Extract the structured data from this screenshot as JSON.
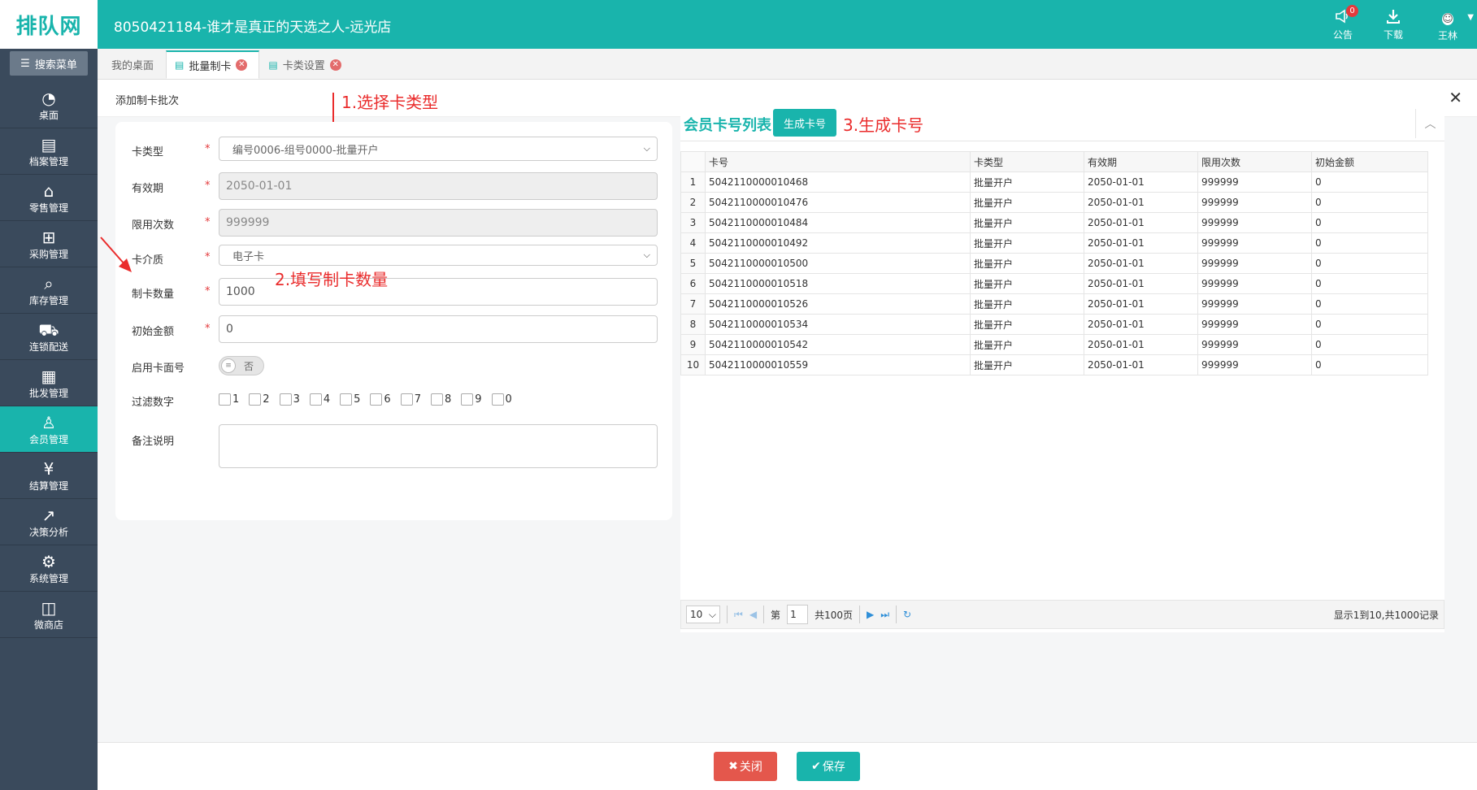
{
  "header": {
    "logo_text": "排队网",
    "title": "8050421184-谁才是真正的天选之人-远光店",
    "actions": [
      {
        "label": "公告",
        "icon": "speaker-icon",
        "badge": "0"
      },
      {
        "label": "下载",
        "icon": "download-icon"
      },
      {
        "label": "王林",
        "icon": "user-avatar-icon"
      }
    ]
  },
  "sidebar": {
    "search_label": "搜索菜单",
    "items": [
      {
        "label": "桌面",
        "icon": "dashboard-icon"
      },
      {
        "label": "档案管理",
        "icon": "archive-icon"
      },
      {
        "label": "零售管理",
        "icon": "store-icon"
      },
      {
        "label": "采购管理",
        "icon": "cart-icon"
      },
      {
        "label": "库存管理",
        "icon": "inventory-search-icon"
      },
      {
        "label": "连锁配送",
        "icon": "truck-icon"
      },
      {
        "label": "批发管理",
        "icon": "wholesale-icon"
      },
      {
        "label": "会员管理",
        "icon": "member-icon",
        "active": true
      },
      {
        "label": "结算管理",
        "icon": "settlement-icon"
      },
      {
        "label": "决策分析",
        "icon": "chart-icon"
      },
      {
        "label": "系统管理",
        "icon": "gear-icon"
      },
      {
        "label": "微商店",
        "icon": "shop-bag-icon"
      }
    ]
  },
  "tabs": [
    {
      "label": "我的桌面"
    },
    {
      "label": "批量制卡",
      "active": true
    },
    {
      "label": "卡类设置"
    }
  ],
  "panel": {
    "title": "添加制卡批次",
    "close_glyph": "✕"
  },
  "annotations": {
    "step1": "1.选择卡类型",
    "step2": "2.填写制卡数量",
    "step3": "3.生成卡号"
  },
  "form": {
    "card_type": {
      "label": "卡类型",
      "value": "编号0006-组号0000-批量开户"
    },
    "valid_until": {
      "label": "有效期",
      "value": "2050-01-01"
    },
    "limit_times": {
      "label": "限用次数",
      "value": "999999"
    },
    "medium": {
      "label": "卡介质",
      "value": "电子卡"
    },
    "count": {
      "label": "制卡数量",
      "value": "1000"
    },
    "initial_amount": {
      "label": "初始金额",
      "value": "0"
    },
    "enable_face_no": {
      "label": "启用卡面号",
      "toggle_text": "否",
      "knob_glyph": "≡"
    },
    "filter_digits": {
      "label": "过滤数字",
      "digits": [
        "1",
        "2",
        "3",
        "4",
        "5",
        "6",
        "7",
        "8",
        "9",
        "0"
      ]
    },
    "remark": {
      "label": "备注说明",
      "value": ""
    },
    "required_mark": "*"
  },
  "card_list": {
    "title": "会员卡号列表",
    "generate_button": "生成卡号",
    "columns": [
      "卡号",
      "卡类型",
      "有效期",
      "限用次数",
      "初始金额"
    ],
    "rows": [
      [
        "5042110000010468",
        "批量开户",
        "2050-01-01",
        "999999",
        "0"
      ],
      [
        "5042110000010476",
        "批量开户",
        "2050-01-01",
        "999999",
        "0"
      ],
      [
        "5042110000010484",
        "批量开户",
        "2050-01-01",
        "999999",
        "0"
      ],
      [
        "5042110000010492",
        "批量开户",
        "2050-01-01",
        "999999",
        "0"
      ],
      [
        "5042110000010500",
        "批量开户",
        "2050-01-01",
        "999999",
        "0"
      ],
      [
        "5042110000010518",
        "批量开户",
        "2050-01-01",
        "999999",
        "0"
      ],
      [
        "5042110000010526",
        "批量开户",
        "2050-01-01",
        "999999",
        "0"
      ],
      [
        "5042110000010534",
        "批量开户",
        "2050-01-01",
        "999999",
        "0"
      ],
      [
        "5042110000010542",
        "批量开户",
        "2050-01-01",
        "999999",
        "0"
      ],
      [
        "5042110000010559",
        "批量开户",
        "2050-01-01",
        "999999",
        "0"
      ]
    ],
    "pager": {
      "page_size": "10",
      "page_prefix": "第",
      "page": "1",
      "total_pages": "共100页",
      "info": "显示1到10,共1000记录"
    }
  },
  "footer": {
    "close_label": "关闭",
    "save_label": "保存"
  },
  "colors": {
    "brand": "#19b4ac",
    "sidebar": "#3a4a5c",
    "danger": "#e4574c",
    "annotation": "#ea2c2c"
  }
}
